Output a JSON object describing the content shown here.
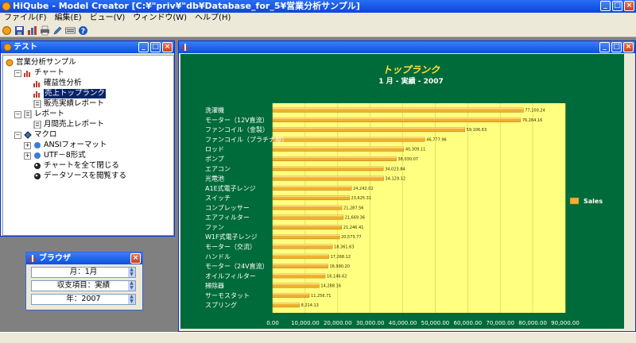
{
  "window": {
    "title": "HiQube - Model Creator [C:¥\"priv¥\"db¥Database_for_5¥営業分析サンプル]"
  },
  "menu": [
    "ファイル(F)",
    "編集(E)",
    "ビュー(V)",
    "ウィンドウ(W)",
    "ヘルプ(H)"
  ],
  "toolbar": {
    "icons": [
      "record-icon",
      "save-icon",
      "model-icon",
      "print-icon",
      "edit-icon",
      "keyboard-icon",
      "help-icon"
    ]
  },
  "tree_window": {
    "title": "テスト",
    "nodes": [
      {
        "label": "営業分析サンプル",
        "icon": "model-root-icon",
        "level": 0,
        "expander": ""
      },
      {
        "label": "チャート",
        "icon": "chart-folder-icon",
        "level": 1,
        "expander": "−"
      },
      {
        "label": "確益性分析",
        "icon": "bar-chart-icon",
        "level": 2,
        "expander": ""
      },
      {
        "label": "売上トップランク",
        "icon": "bar-chart-icon",
        "level": 2,
        "expander": "",
        "selected": true
      },
      {
        "label": "販売実績レポート",
        "icon": "report-icon",
        "level": 2,
        "expander": ""
      },
      {
        "label": "レポート",
        "icon": "report-folder-icon",
        "level": 1,
        "expander": "−"
      },
      {
        "label": "月間売上レポート",
        "icon": "report-icon",
        "level": 2,
        "expander": ""
      },
      {
        "label": "マクロ",
        "icon": "macro-folder-icon",
        "level": 1,
        "expander": "−"
      },
      {
        "label": "ANSIフォーマット",
        "icon": "format-icon",
        "level": 2,
        "expander": "+"
      },
      {
        "label": "UTF－8形式",
        "icon": "format-icon",
        "level": 2,
        "expander": "+"
      },
      {
        "label": "チャートを全て閉じる",
        "icon": "macro-icon",
        "level": 2,
        "expander": ""
      },
      {
        "label": "データソースを閲覧する",
        "icon": "macro-icon",
        "level": 2,
        "expander": ""
      }
    ]
  },
  "browser_window": {
    "title": "ブラウザ",
    "filters": [
      "月：1月",
      "収支項目：実績",
      "年：2007"
    ]
  },
  "chart_window": {
    "title": ""
  },
  "chart_data": {
    "type": "bar",
    "orientation": "horizontal",
    "title": "トップランク",
    "subtitle": "1 月 - 実績 - 2007",
    "xlim": [
      0,
      90000
    ],
    "xticks": [
      "0.00",
      "10,000.00",
      "20,000.00",
      "30,000.00",
      "40,000.00",
      "50,000.00",
      "60,000.00",
      "70,000.00",
      "80,000.00",
      "90,000.00"
    ],
    "legend_position": "right",
    "series": [
      {
        "name": "Sales",
        "color": "#f0b030",
        "categories": [
          "洗濯機",
          "モーター（12V直流）",
          "ファンコイル（金製）",
          "ファンコイル（プラチナ製）",
          "ロッド",
          "ポンプ",
          "エアコン",
          "光電池",
          "A1E式電子レンジ",
          "スイッチ",
          "コンプレッサー",
          "エアフィルター",
          "ファン",
          "W1F式電子レンジ",
          "モーター（交流）",
          "ハンドル",
          "モーター（24V直流）",
          "オイルフィルター",
          "掃除器",
          "サーモスタット",
          "スプリング"
        ],
        "values": [
          77100.24,
          76264.16,
          59106.63,
          46777.96,
          40309.11,
          38030.07,
          34023.84,
          34129.12,
          24242.02,
          23625.31,
          21287.56,
          21669.36,
          21246.41,
          20573.77,
          18361.63,
          17268.12,
          16990.2,
          16146.62,
          14288.16,
          11256.71,
          8214.13
        ],
        "labels": [
          "77,100.24",
          "76,264.16",
          "59,106.63",
          "46,777.96",
          "40,309.11",
          "38,030.07",
          "34,023.84",
          "34,129.12",
          "24,242.02",
          "23,625.31",
          "21,287.56",
          "21,669.36",
          "21,246.41",
          "20,573.77",
          "18,361.63",
          "17,268.12",
          "16,990.20",
          "16,146.62",
          "14,288.16",
          "11,256.71",
          "8,214.13"
        ]
      }
    ]
  }
}
